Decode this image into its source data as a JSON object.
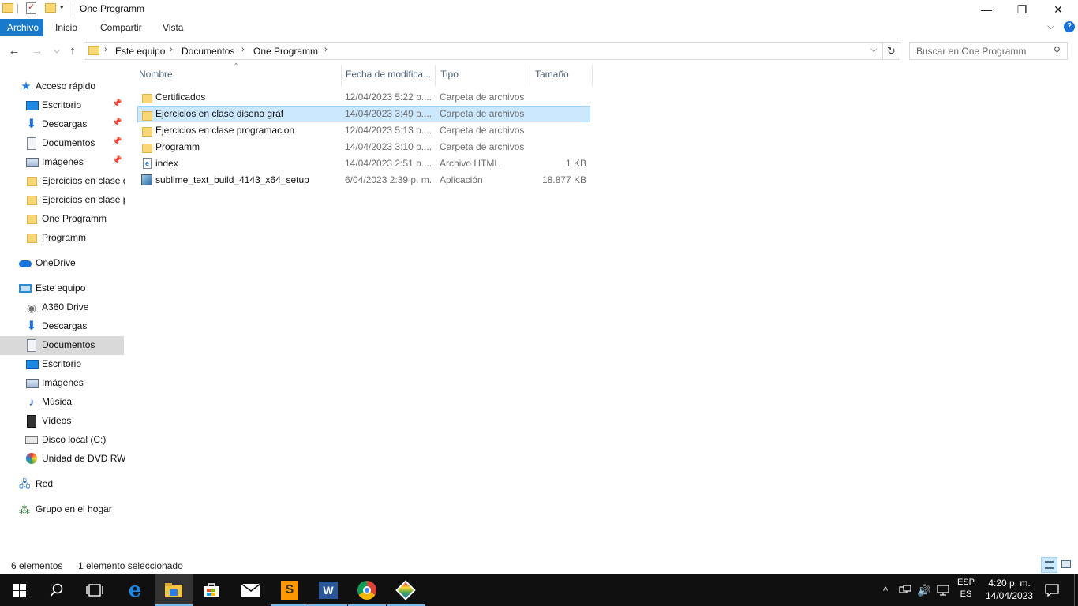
{
  "window": {
    "title": "One Programm",
    "controls": {
      "minimize": "—",
      "maximize": "❐",
      "close": "✕"
    }
  },
  "ribbon": {
    "tabs": [
      "Archivo",
      "Inicio",
      "Compartir",
      "Vista"
    ],
    "expand": "⌵",
    "help": "?"
  },
  "address": {
    "breadcrumb": [
      "Este equipo",
      "Documentos",
      "One Programm"
    ],
    "search_placeholder": "Buscar en One Programm"
  },
  "nav": {
    "items": [
      {
        "label": "Acceso rápido",
        "icon": "star-icon",
        "pinned": false
      },
      {
        "label": "Escritorio",
        "icon": "desktop-icon",
        "pinned": true
      },
      {
        "label": "Descargas",
        "icon": "download-icon",
        "pinned": true
      },
      {
        "label": "Documentos",
        "icon": "document-icon",
        "pinned": true
      },
      {
        "label": "Imágenes",
        "icon": "image-icon",
        "pinned": true
      },
      {
        "label": "Ejercicios en clase d",
        "icon": "folder-icon",
        "pinned": false
      },
      {
        "label": "Ejercicios en clase p",
        "icon": "folder-icon",
        "pinned": false
      },
      {
        "label": "One Programm",
        "icon": "folder-icon",
        "pinned": false
      },
      {
        "label": "Programm",
        "icon": "folder-icon",
        "pinned": false
      },
      {
        "label": "OneDrive",
        "icon": "cloud-icon",
        "pinned": false
      },
      {
        "label": "Este equipo",
        "icon": "computer-icon",
        "pinned": false
      },
      {
        "label": "A360 Drive",
        "icon": "a360-drive-icon",
        "pinned": false
      },
      {
        "label": "Descargas",
        "icon": "download-icon",
        "pinned": false
      },
      {
        "label": "Documentos",
        "icon": "document-icon",
        "pinned": false,
        "selected": true
      },
      {
        "label": "Escritorio",
        "icon": "desktop-icon",
        "pinned": false
      },
      {
        "label": "Imágenes",
        "icon": "image-icon",
        "pinned": false
      },
      {
        "label": "Música",
        "icon": "music-icon",
        "pinned": false
      },
      {
        "label": "Vídeos",
        "icon": "video-icon",
        "pinned": false
      },
      {
        "label": "Disco local (C:)",
        "icon": "disk-icon",
        "pinned": false
      },
      {
        "label": "Unidad de DVD RW",
        "icon": "dvd-icon",
        "pinned": false
      },
      {
        "label": "Red",
        "icon": "network-icon",
        "pinned": false
      },
      {
        "label": "Grupo en el hogar",
        "icon": "homegroup-icon",
        "pinned": false
      }
    ]
  },
  "columns": {
    "name": "Nombre",
    "date": "Fecha de modifica...",
    "type": "Tipo",
    "size": "Tamaño"
  },
  "files": [
    {
      "name": "Certificados",
      "date": "12/04/2023 5:22 p....",
      "type": "Carpeta de archivos",
      "size": "",
      "icon": "folder-icon",
      "selected": false
    },
    {
      "name": "Ejercicios en clase diseno graf",
      "date": "14/04/2023 3:49 p....",
      "type": "Carpeta de archivos",
      "size": "",
      "icon": "folder-icon",
      "selected": true
    },
    {
      "name": "Ejercicios en clase programacion",
      "date": "12/04/2023 5:13 p....",
      "type": "Carpeta de archivos",
      "size": "",
      "icon": "folder-icon",
      "selected": false
    },
    {
      "name": "Programm",
      "date": "14/04/2023 3:10 p....",
      "type": "Carpeta de archivos",
      "size": "",
      "icon": "folder-icon",
      "selected": false
    },
    {
      "name": "index",
      "date": "14/04/2023 2:51 p....",
      "type": "Archivo HTML",
      "size": "1 KB",
      "icon": "html-file-icon",
      "selected": false
    },
    {
      "name": "sublime_text_build_4143_x64_setup",
      "date": "6/04/2023 2:39 p. m.",
      "type": "Aplicación",
      "size": "18.877 KB",
      "icon": "installer-icon",
      "selected": false
    }
  ],
  "status": {
    "count": "6 elementos",
    "selection": "1 elemento seleccionado"
  },
  "taskbar": {
    "apps": [
      "start-icon",
      "search-icon",
      "task-view-icon",
      "edge-icon",
      "file-explorer-icon",
      "store-icon",
      "mail-icon",
      "sublime-text-icon",
      "word-icon",
      "chrome-icon",
      "git-icon"
    ],
    "lang_top": "ESP",
    "lang_bottom": "ES",
    "time": "4:20 p. m.",
    "date": "14/04/2023"
  }
}
